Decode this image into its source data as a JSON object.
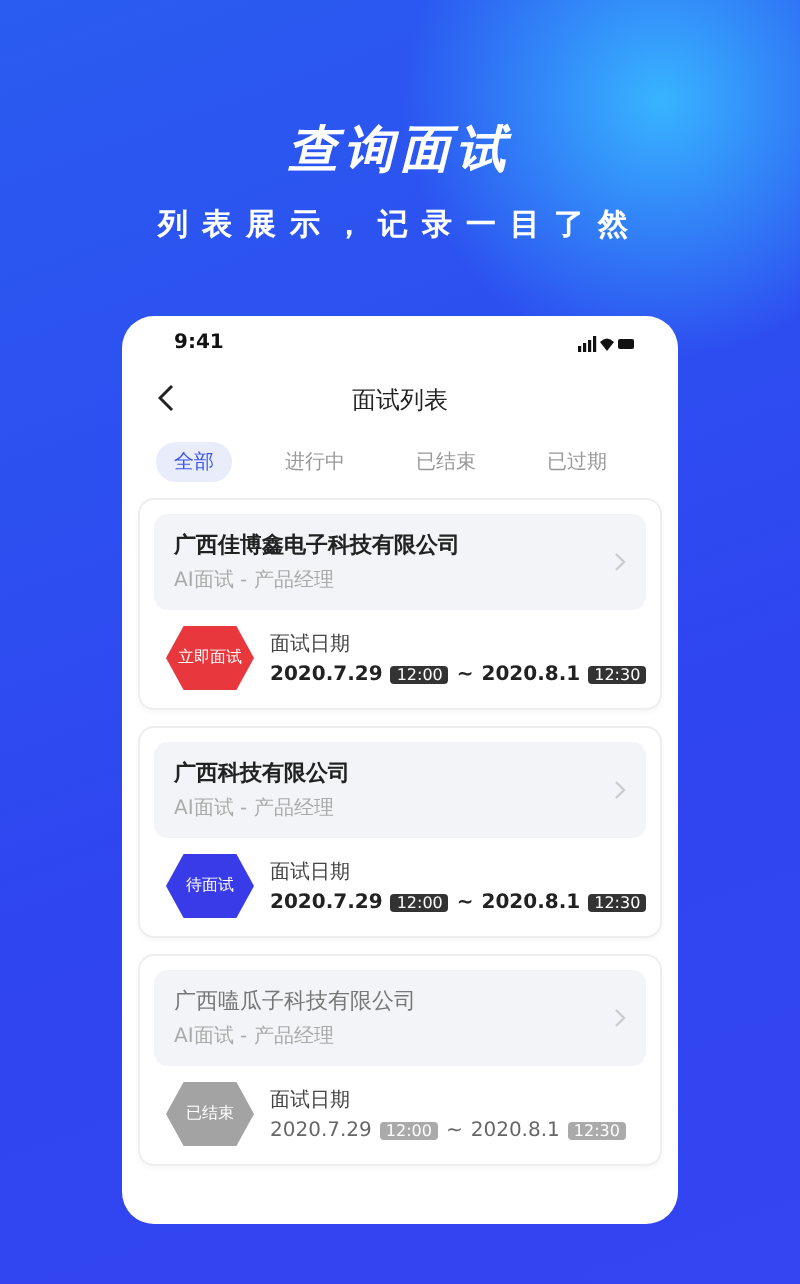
{
  "headline": "查询面试",
  "subheadline": "列表展示，记录一目了然",
  "phone": {
    "status_bar": {
      "time": "9:41"
    },
    "nav": {
      "title": "面试列表"
    },
    "tabs": [
      {
        "label": "全部",
        "selected": true
      },
      {
        "label": "进行中",
        "selected": false
      },
      {
        "label": "已结束",
        "selected": false
      },
      {
        "label": "已过期",
        "selected": false
      }
    ],
    "interviews": [
      {
        "company": "广西佳博鑫电子科技有限公司",
        "detail": "AI面试 - 产品经理",
        "kind": "start",
        "badge": "立即面试",
        "date_label": "面试日期",
        "start_date": "2020.7.29",
        "start_time": "12:00",
        "separator": "~",
        "end_date": "2020.8.1",
        "end_time": "12:30"
      },
      {
        "company": "广西科技有限公司",
        "detail": "AI面试 - 产品经理",
        "kind": "pending",
        "badge": "待面试",
        "date_label": "面试日期",
        "start_date": "2020.7.29",
        "start_time": "12:00",
        "separator": "~",
        "end_date": "2020.8.1",
        "end_time": "12:30"
      },
      {
        "company": "广西嗑瓜子科技有限公司",
        "detail": "AI面试 - 产品经理",
        "kind": "ended",
        "badge": "已结束",
        "date_label": "面试日期",
        "start_date": "2020.7.29",
        "start_time": "12:00",
        "separator": "~",
        "end_date": "2020.8.1",
        "end_time": "12:30"
      }
    ]
  }
}
